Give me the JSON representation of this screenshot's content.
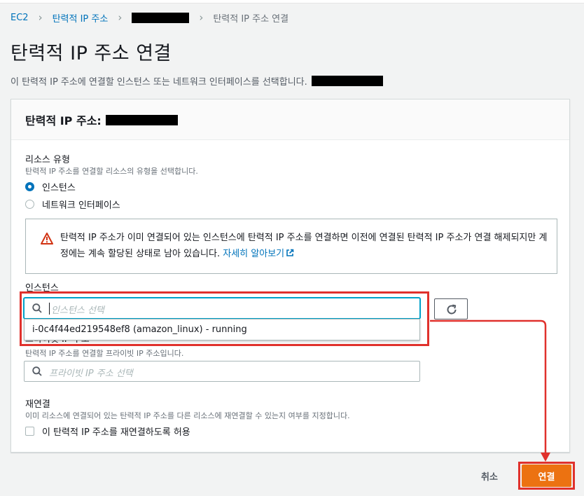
{
  "breadcrumb": {
    "root": "EC2",
    "parent": "탄력적 IP 주소",
    "current": "탄력적 IP 주소 연결"
  },
  "page": {
    "title": "탄력적 IP 주소 연결",
    "description": "이 탄력적 IP 주소에 연결할 인스턴스 또는 네트워크 인터페이스를 선택합니다."
  },
  "panel": {
    "title": "탄력적 IP 주소:"
  },
  "resource_type": {
    "label": "리소스 유형",
    "hint": "탄력적 IP 주소를 연결할 리소스의 유형을 선택합니다.",
    "options": [
      {
        "label": "인스턴스",
        "selected": true
      },
      {
        "label": "네트워크 인터페이스",
        "selected": false
      }
    ]
  },
  "alert": {
    "text": "탄력적 IP 주소가 이미 연결되어 있는 인스턴스에 탄력적 IP 주소를 연결하면 이전에 연결된 탄력적 IP 주소가 연결 해제되지만 계정에는 계속 할당된 상태로 남아 있습니다.",
    "link": "자세히 알아보기"
  },
  "instance": {
    "label": "인스턴스",
    "placeholder": "인스턴스 선택",
    "dropdown_option": "i-0c4f44ed219548ef8 (amazon_linux) - running"
  },
  "private_ip": {
    "label": "프라이빗 IP 주소",
    "hint": "탄력적 IP 주소를 연결할 프라이빗 IP 주소입니다.",
    "placeholder": "프라이빗 IP 주소 선택"
  },
  "reassociate": {
    "label": "재연결",
    "hint": "이미 리소스에 연결되어 있는 탄력적 IP 주소를 다른 리소스에 재연결할 수 있는지 여부를 지정합니다.",
    "checkbox_label": "이 탄력적 IP 주소를 재연결하도록 허용",
    "checked": false
  },
  "footer": {
    "cancel": "취소",
    "submit": "연결"
  },
  "colors": {
    "link": "#0073bb",
    "primary": "#ec7211",
    "highlight": "#e0312c",
    "focus": "#00a1c9"
  },
  "icons": [
    "search-icon",
    "warning-icon",
    "external-link-icon",
    "refresh-icon"
  ]
}
